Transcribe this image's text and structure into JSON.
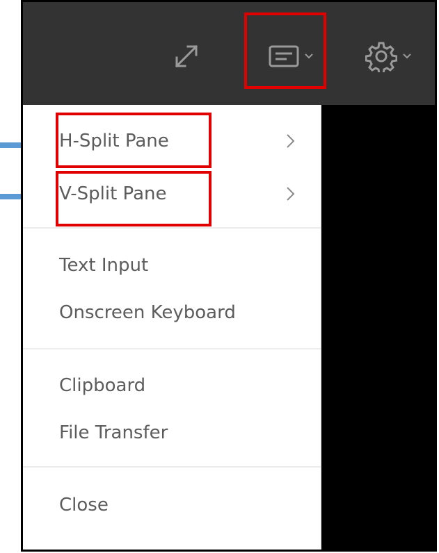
{
  "menu": {
    "items": [
      {
        "label": "H-Split Pane",
        "has_submenu": true
      },
      {
        "label": "V-Split Pane",
        "has_submenu": true
      },
      {
        "label": "Text Input",
        "has_submenu": false
      },
      {
        "label": "Onscreen Keyboard",
        "has_submenu": false
      },
      {
        "label": "Clipboard",
        "has_submenu": false
      },
      {
        "label": "File Transfer",
        "has_submenu": false
      },
      {
        "label": "Close",
        "has_submenu": false
      }
    ]
  },
  "toolbar": {
    "icons": [
      "expand-icon",
      "menu-icon",
      "chevron-down-icon",
      "settings-gear-icon",
      "chevron-down-icon"
    ]
  },
  "colors": {
    "toolbar_bg": "#333333",
    "highlight": "#e00000",
    "callout": "#5b9bd5",
    "menu_text": "#5c5c5c"
  }
}
